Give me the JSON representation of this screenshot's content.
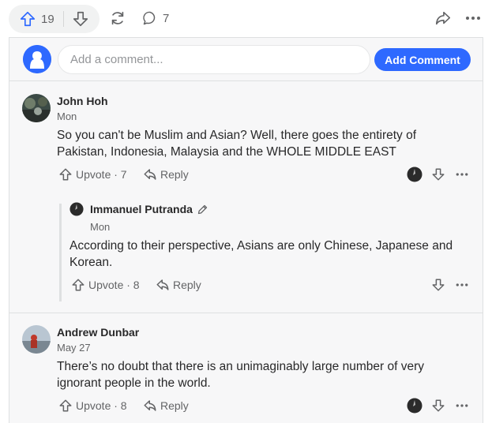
{
  "actions": {
    "upvote_count": "19",
    "comment_count": "7"
  },
  "composer": {
    "placeholder": "Add a comment...",
    "button_label": "Add Comment"
  },
  "comments": [
    {
      "author": "John Hoh",
      "time": "Mon",
      "text": "So you can't be Muslim and Asian? Well, there goes the entirety of Pakistan, Indonesia, Malaysia and the WHOLE MIDDLE EAST",
      "upvote_label": "Upvote · 7",
      "reply_label": "Reply"
    },
    {
      "author": "Immanuel Putranda",
      "time": "Mon",
      "text": "According to their perspective, Asians are only Chinese, Japanese and Korean.",
      "upvote_label": "Upvote · 8",
      "reply_label": "Reply"
    },
    {
      "author": "Andrew Dunbar",
      "time": "May 27",
      "text": "There’s no doubt that there is an unimaginably large number of very ignorant people in the world.",
      "upvote_label": "Upvote · 8",
      "reply_label": "Reply"
    }
  ],
  "icons": {
    "upvote": "upvote-arrow-icon",
    "downvote": "downvote-arrow-icon",
    "share": "reshare-icon",
    "comment": "comment-bubble-icon",
    "forward": "share-forward-icon",
    "more": "more-dots-icon",
    "reply": "reply-icon",
    "edit": "pencil-icon"
  },
  "colors": {
    "accent": "#2e69ff",
    "muted": "#636466",
    "panel_bg": "#f7f7f8"
  }
}
